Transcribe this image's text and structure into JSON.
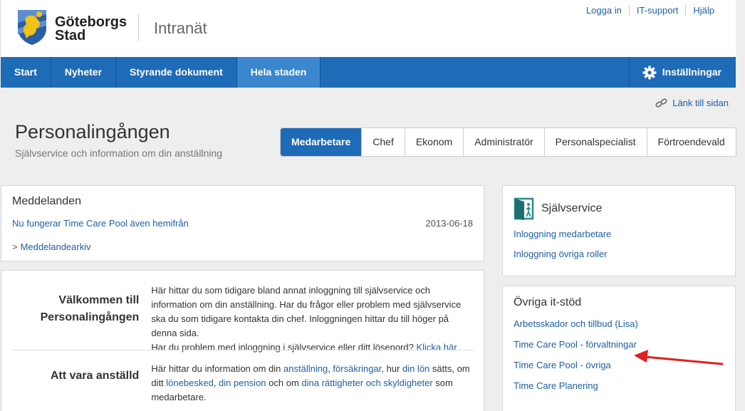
{
  "header": {
    "logo_line1": "Göteborgs",
    "logo_line2": "Stad",
    "site_name": "Intranät",
    "links": [
      "Logga in",
      "IT-support",
      "Hjälp"
    ]
  },
  "nav": {
    "items": [
      "Start",
      "Nyheter",
      "Styrande dokument",
      "Hela staden"
    ],
    "active_index": 3,
    "settings_label": "Inställningar"
  },
  "link_to_page": "Länk till sidan",
  "page": {
    "title": "Personalingången",
    "subtitle": "Självservice och information om din anställning"
  },
  "role_tabs": {
    "items": [
      "Medarbetare",
      "Chef",
      "Ekonom",
      "Administratör",
      "Personalspecialist",
      "Förtroendevald"
    ],
    "active_index": 0
  },
  "messages": {
    "heading": "Meddelanden",
    "items": [
      {
        "text": "Nu fungerar Time Care Pool även hemifrån",
        "date": "2013-06-18"
      }
    ],
    "archive_label": "Meddelandearkiv"
  },
  "intro": {
    "welcome_heading": "Välkommen till Personalingången",
    "welcome_text": "Här hittar du som tidigare bland annat inloggning till självservice och information om din anställning. Har du frågor eller problem med självservice ska du som tidigare kontakta din chef. Inloggningen hittar du till höger på denna sida.",
    "welcome_text2": "Har du problem med inloggning i självservice eller ditt lösenord?",
    "welcome_link": "Klicka här",
    "employed_heading": "Att vara anställd",
    "employed_parts": [
      "Här hittar du information om din ",
      "anställning",
      ", ",
      "försäkringar",
      ", hur ",
      "din lön",
      " sätts, om ditt ",
      "lönebesked",
      ", ",
      "din pension",
      " och om ",
      "dina rättigheter och skyldigheter",
      " som medarbetare."
    ]
  },
  "selfservice": {
    "heading": "Självservice",
    "links": [
      "Inloggning medarbetare",
      "Inloggning övriga roller"
    ]
  },
  "other_it": {
    "heading": "Övriga it-stöd",
    "links": [
      "Arbetsskador och tillbud (Lisa)",
      "Time Care Pool - förvaltningar",
      "Time Care Pool - övriga",
      "Time Care Planering"
    ]
  },
  "colors": {
    "nav_blue": "#1e6bb8",
    "nav_active": "#3a86cf",
    "link": "#1f5fa3",
    "arrow": "#e02020"
  }
}
